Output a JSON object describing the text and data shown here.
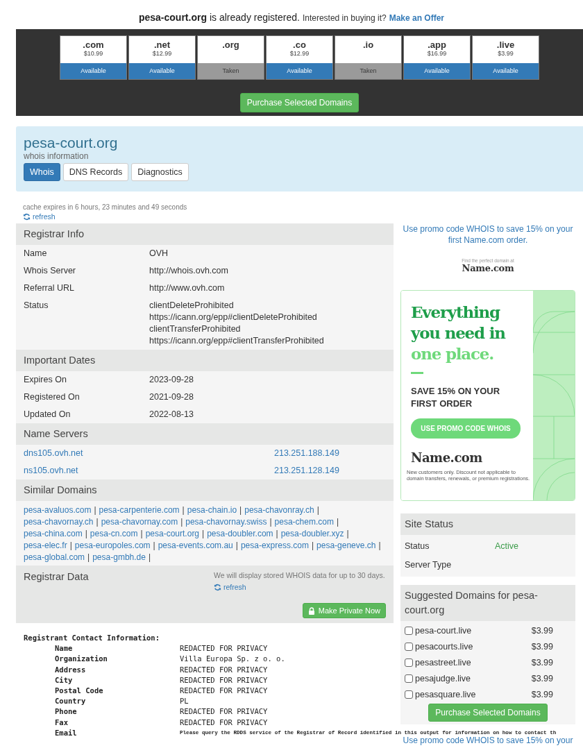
{
  "notice": {
    "domain": "pesa-court.org",
    "text": "is already registered.",
    "question": "Interested in buying it?",
    "link": "Make an Offer"
  },
  "tlds": [
    {
      "ext": ".com",
      "price": "$10.99",
      "status": "Available",
      "available": true
    },
    {
      "ext": ".net",
      "price": "$12.99",
      "status": "Available",
      "available": true
    },
    {
      "ext": ".org",
      "status": "Taken",
      "available": false
    },
    {
      "ext": ".co",
      "price": "$12.99",
      "status": "Available",
      "available": true
    },
    {
      "ext": ".io",
      "status": "Taken",
      "available": false
    },
    {
      "ext": ".app",
      "price": "$16.99",
      "status": "Available",
      "available": true
    },
    {
      "ext": ".live",
      "price": "$3.99",
      "status": "Available",
      "available": true
    }
  ],
  "purchase_button": "Purchase Selected Domains",
  "header": {
    "title": "pesa-court.org",
    "subtitle": "whois information",
    "tabs": [
      {
        "label": "Whois",
        "selected": true
      },
      {
        "label": "DNS Records",
        "selected": false
      },
      {
        "label": "Diagnostics",
        "selected": false
      }
    ]
  },
  "cache": {
    "text": "cache expires in 6 hours, 23 minutes and 49 seconds",
    "refresh": "refresh"
  },
  "registrar_info": {
    "title": "Registrar Info",
    "rows": [
      {
        "label": "Name",
        "values": [
          "OVH"
        ]
      },
      {
        "label": "Whois Server",
        "values": [
          "http://whois.ovh.com"
        ]
      },
      {
        "label": "Referral URL",
        "values": [
          "http://www.ovh.com"
        ]
      },
      {
        "label": "Status",
        "values": [
          "clientDeleteProhibited",
          "https://icann.org/epp#clientDeleteProhibited",
          "clientTransferProhibited",
          "https://icann.org/epp#clientTransferProhibited"
        ]
      }
    ]
  },
  "important_dates": {
    "title": "Important Dates",
    "rows": [
      {
        "label": "Expires On",
        "values": [
          "2023-09-28"
        ]
      },
      {
        "label": "Registered On",
        "values": [
          "2021-09-28"
        ]
      },
      {
        "label": "Updated On",
        "values": [
          "2022-08-13"
        ]
      }
    ]
  },
  "name_servers": {
    "title": "Name Servers",
    "rows": [
      {
        "host": "dns105.ovh.net",
        "ip": "213.251.188.149"
      },
      {
        "host": "ns105.ovh.net",
        "ip": "213.251.128.149"
      }
    ]
  },
  "similar_domains": {
    "title": "Similar Domains",
    "separator": "|",
    "links": [
      "pesa-avaluos.com",
      "pesa-carpenterie.com",
      "pesa-chain.io",
      "pesa-chavonray.ch",
      "pesa-chavornay.ch",
      "pesa-chavornay.com",
      "pesa-chavornay.swiss",
      "pesa-chem.com",
      "pesa-china.com",
      "pesa-cn.com",
      "pesa-court.org",
      "pesa-doubler.com",
      "pesa-doubler.xyz",
      "pesa-elec.fr",
      "pesa-europoles.com",
      "pesa-events.com.au",
      "pesa-express.com",
      "pesa-geneve.ch",
      "pesa-global.com",
      "pesa-gmbh.de"
    ]
  },
  "registrar_data": {
    "title": "Registrar Data",
    "note": "We will display stored WHOIS data for up to 30 days.",
    "refresh": "refresh",
    "button": "Make Private Now",
    "contact": {
      "heading": "Registrant Contact Information:",
      "rows": [
        {
          "label": "Name",
          "value": "REDACTED FOR PRIVACY",
          "kind": "field"
        },
        {
          "label": "Organization",
          "value": "Villa Europa Sp. z o. o.",
          "kind": "field"
        },
        {
          "label": "Address",
          "value": "REDACTED FOR PRIVACY",
          "kind": "field"
        },
        {
          "label": "City",
          "value": "REDACTED FOR PRIVACY",
          "kind": "field"
        },
        {
          "label": "Postal Code",
          "value": "REDACTED FOR PRIVACY",
          "kind": "field"
        },
        {
          "label": "Country",
          "value": "PL",
          "kind": "field"
        },
        {
          "label": "Phone",
          "value": "REDACTED FOR PRIVACY",
          "kind": "field"
        },
        {
          "label": "Fax",
          "value": "REDACTED FOR PRIVACY",
          "kind": "field"
        },
        {
          "label": "Email",
          "value": "Please query the RDDS service of the Registrar of Record identified in this output for information on how to contact th",
          "kind": "notice"
        }
      ]
    }
  },
  "promo": "Use promo code WHOIS to save 15% on your first Name.com order.",
  "partner": {
    "tagline": "Find the perfect domain at",
    "logo": "Name.com"
  },
  "ad": {
    "headline": "Everything you need in",
    "accent": "one place.",
    "offer": "SAVE 15% ON YOUR FIRST ORDER",
    "button": "USE PROMO CODE WHOIS",
    "logo": "Name.com",
    "fine_print": "New customers only. Discount not applicable to domain transfers, renewals, or premium registrations."
  },
  "site_status": {
    "title": "Site Status",
    "rows": [
      {
        "label": "Status",
        "value": "Active",
        "kind": "good"
      },
      {
        "label": "Server Type"
      }
    ]
  },
  "suggested": {
    "title": "Suggested Domains for pesa-court.org",
    "items": [
      {
        "domain": "pesa-court.live",
        "price": "$3.99",
        "checked": false
      },
      {
        "domain": "pesacourts.live",
        "price": "$3.99",
        "checked": false
      },
      {
        "domain": "pesastreet.live",
        "price": "$3.99",
        "checked": false
      },
      {
        "domain": "pesajudge.live",
        "price": "$3.99",
        "checked": false
      },
      {
        "domain": "pesasquare.live",
        "price": "$3.99",
        "checked": false
      }
    ],
    "button": "Purchase Selected Domains"
  },
  "bottom_promo": "Use promo code WHOIS to save 15% on your"
}
